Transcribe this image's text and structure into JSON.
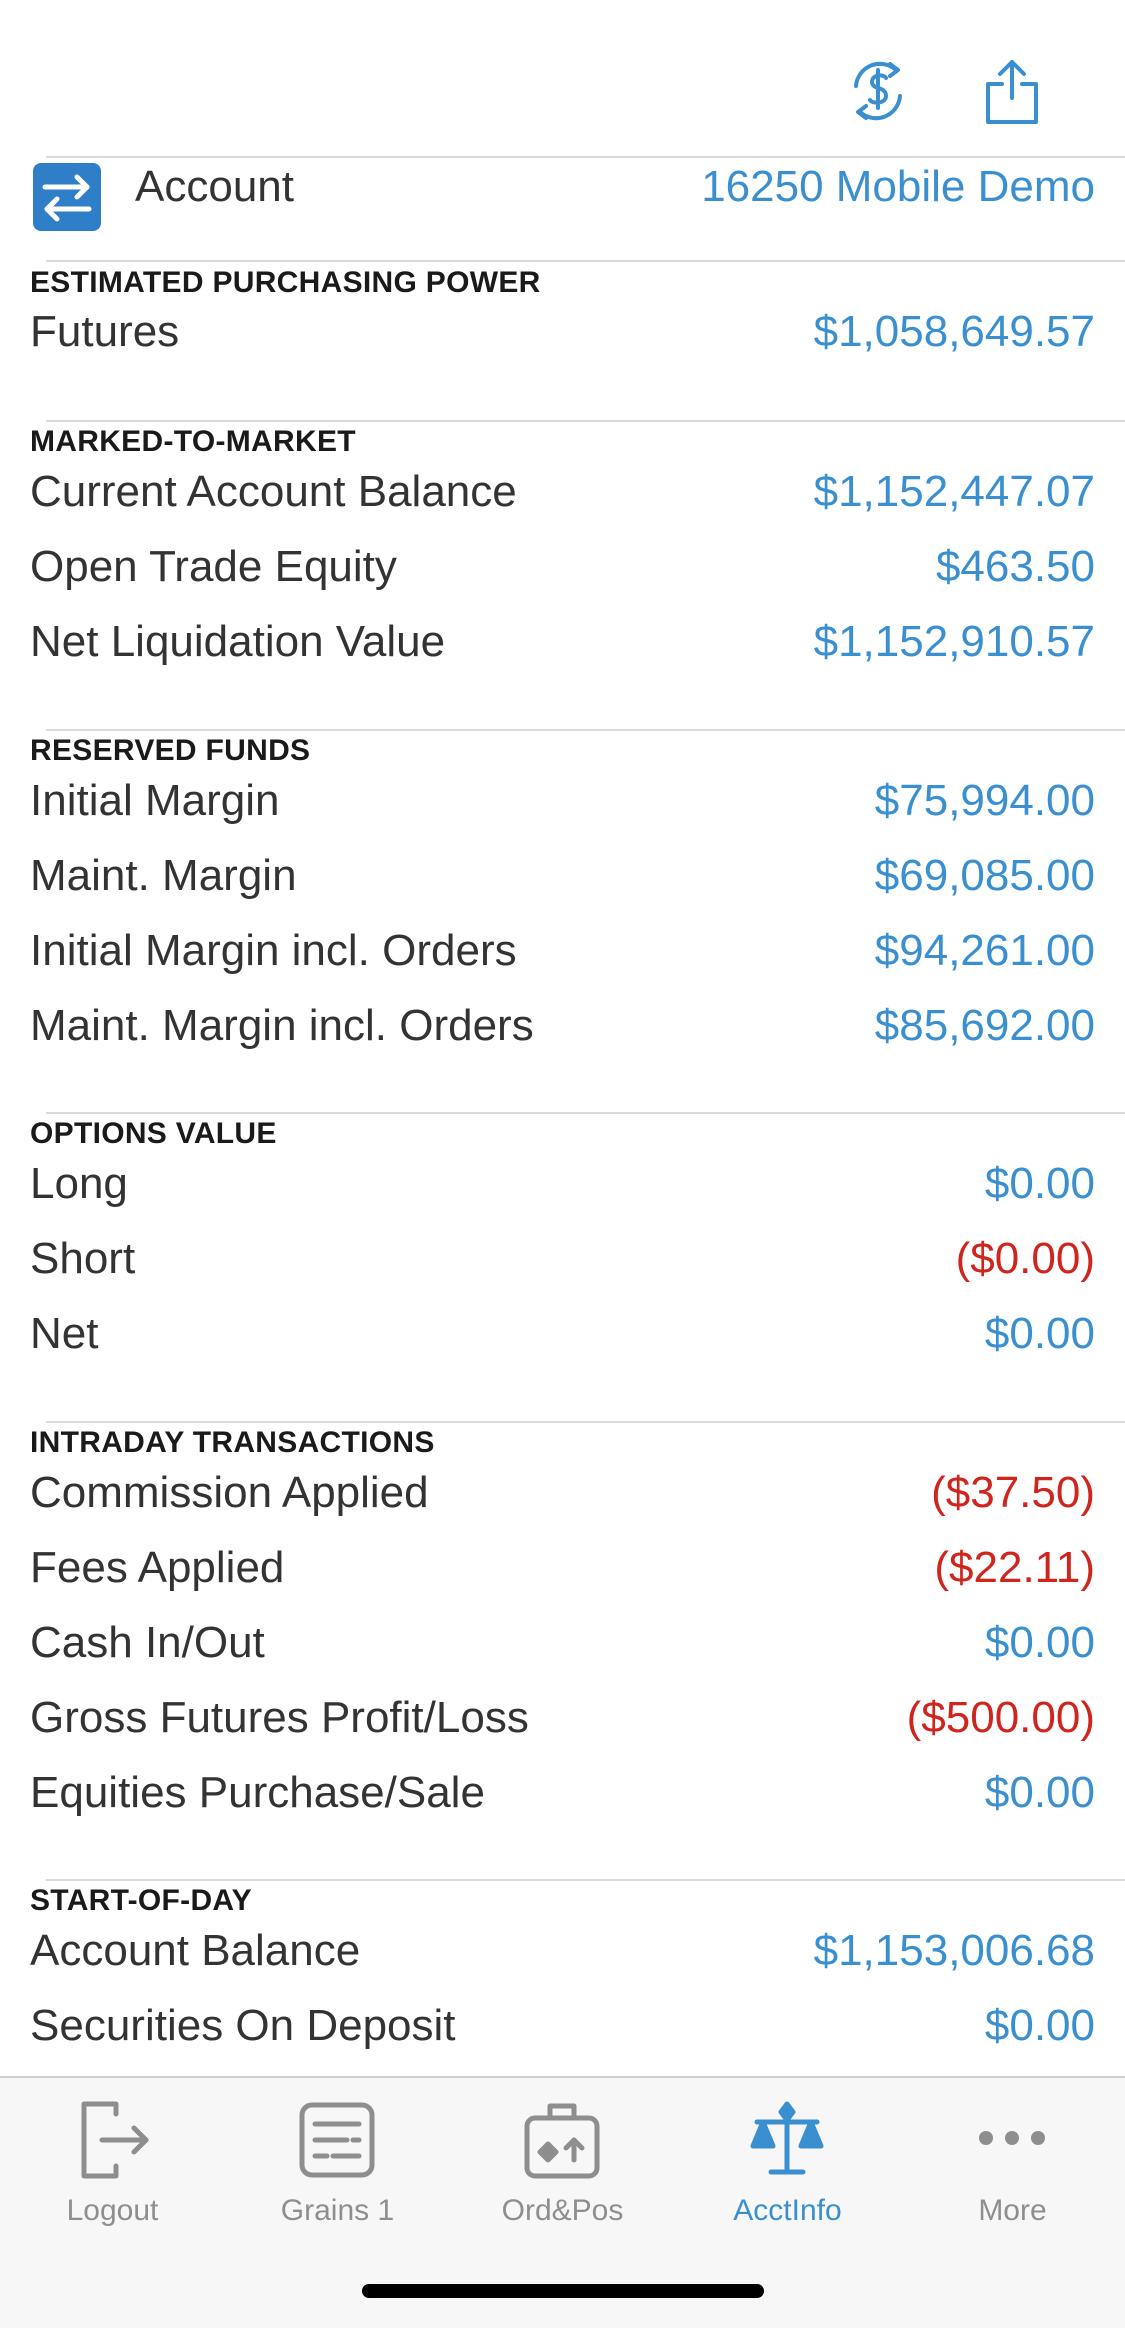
{
  "toolbar": {
    "exchange_icon": "currency-exchange-icon",
    "share_icon": "share-icon"
  },
  "account": {
    "icon": "swap-arrows-icon",
    "label": "Account",
    "value": "16250 Mobile Demo"
  },
  "sections": {
    "purchasing": {
      "header": "ESTIMATED PURCHASING POWER",
      "rows": [
        {
          "label": "Futures",
          "value": "$1,058,649.57"
        }
      ]
    },
    "mtm": {
      "header": "MARKED-TO-MARKET",
      "rows": [
        {
          "label": "Current Account Balance",
          "value": "$1,152,447.07"
        },
        {
          "label": "Open Trade Equity",
          "value": "$463.50"
        },
        {
          "label": "Net Liquidation Value",
          "value": "$1,152,910.57"
        }
      ]
    },
    "reserved": {
      "header": "RESERVED FUNDS",
      "rows": [
        {
          "label": "Initial Margin",
          "value": "$75,994.00"
        },
        {
          "label": "Maint. Margin",
          "value": "$69,085.00"
        },
        {
          "label": "Initial Margin incl. Orders",
          "value": "$94,261.00"
        },
        {
          "label": "Maint. Margin incl. Orders",
          "value": "$85,692.00"
        }
      ]
    },
    "options": {
      "header": "OPTIONS VALUE",
      "rows": [
        {
          "label": "Long",
          "value": "$0.00"
        },
        {
          "label": "Short",
          "value": "($0.00)"
        },
        {
          "label": "Net",
          "value": "$0.00"
        }
      ]
    },
    "intraday": {
      "header": "INTRADAY TRANSACTIONS",
      "rows": [
        {
          "label": "Commission Applied",
          "value": "($37.50)"
        },
        {
          "label": "Fees Applied",
          "value": "($22.11)"
        },
        {
          "label": "Cash In/Out",
          "value": "$0.00"
        },
        {
          "label": "Gross Futures Profit/Loss",
          "value": "($500.00)"
        },
        {
          "label": "Equities Purchase/Sale",
          "value": "$0.00"
        }
      ]
    },
    "sod": {
      "header": "START-OF-DAY",
      "rows": [
        {
          "label": "Account Balance",
          "value": "$1,153,006.68"
        },
        {
          "label": "Securities On Deposit",
          "value": "$0.00"
        }
      ]
    }
  },
  "colors": {
    "accent": "#3a8fd0",
    "negative": "#d0251d",
    "tab_inactive": "#8e8e8e"
  },
  "tabbar": {
    "tabs": [
      {
        "label": "Logout",
        "icon": "logout-icon"
      },
      {
        "label": "Grains 1",
        "icon": "quote-board-icon"
      },
      {
        "label": "Ord&Pos",
        "icon": "briefcase-icon"
      },
      {
        "label": "AcctInfo",
        "icon": "scales-icon",
        "active": true
      },
      {
        "label": "More",
        "icon": "ellipsis-icon"
      }
    ]
  }
}
